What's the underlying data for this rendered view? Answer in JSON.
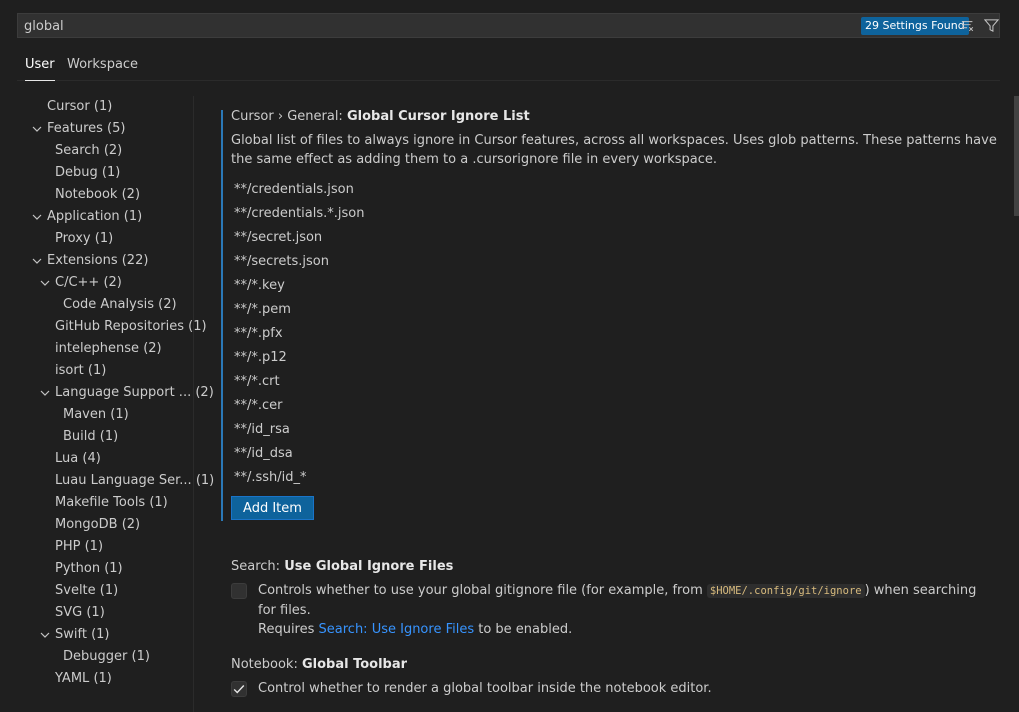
{
  "search": {
    "value": "global",
    "count_label": "29 Settings Found",
    "clear_icon": "clear-filter-icon",
    "filter_icon": "filter-icon"
  },
  "tabs": [
    {
      "label": "User",
      "active": true
    },
    {
      "label": "Workspace",
      "active": false
    }
  ],
  "toc": [
    {
      "label": "Cursor",
      "count": "(1)",
      "depth": 0,
      "expanded": null
    },
    {
      "label": "Features",
      "count": "(5)",
      "depth": 0,
      "expanded": true
    },
    {
      "label": "Search",
      "count": "(2)",
      "depth": 1,
      "expanded": null
    },
    {
      "label": "Debug",
      "count": "(1)",
      "depth": 1,
      "expanded": null
    },
    {
      "label": "Notebook",
      "count": "(2)",
      "depth": 1,
      "expanded": null
    },
    {
      "label": "Application",
      "count": "(1)",
      "depth": 0,
      "expanded": true
    },
    {
      "label": "Proxy",
      "count": "(1)",
      "depth": 1,
      "expanded": null
    },
    {
      "label": "Extensions",
      "count": "(22)",
      "depth": 0,
      "expanded": true
    },
    {
      "label": "C/C++",
      "count": "(2)",
      "depth": 1,
      "expanded": true
    },
    {
      "label": "Code Analysis",
      "count": "(2)",
      "depth": 2,
      "expanded": null
    },
    {
      "label": "GitHub Repositories",
      "count": "(1)",
      "depth": 1,
      "expanded": null
    },
    {
      "label": "intelephense",
      "count": "(2)",
      "depth": 1,
      "expanded": null
    },
    {
      "label": "isort",
      "count": "(1)",
      "depth": 1,
      "expanded": null
    },
    {
      "label": "Language Support ...",
      "count": "(2)",
      "depth": 1,
      "expanded": true,
      "truncated": true
    },
    {
      "label": "Maven",
      "count": "(1)",
      "depth": 2,
      "expanded": null
    },
    {
      "label": "Build",
      "count": "(1)",
      "depth": 2,
      "expanded": null
    },
    {
      "label": "Lua",
      "count": "(4)",
      "depth": 1,
      "expanded": null
    },
    {
      "label": "Luau Language Ser...",
      "count": "(1)",
      "depth": 1,
      "expanded": null,
      "truncated": true
    },
    {
      "label": "Makefile Tools",
      "count": "(1)",
      "depth": 1,
      "expanded": null
    },
    {
      "label": "MongoDB",
      "count": "(2)",
      "depth": 1,
      "expanded": null
    },
    {
      "label": "PHP",
      "count": "(1)",
      "depth": 1,
      "expanded": null
    },
    {
      "label": "Python",
      "count": "(1)",
      "depth": 1,
      "expanded": null
    },
    {
      "label": "Svelte",
      "count": "(1)",
      "depth": 1,
      "expanded": null
    },
    {
      "label": "SVG",
      "count": "(1)",
      "depth": 1,
      "expanded": null
    },
    {
      "label": "Swift",
      "count": "(1)",
      "depth": 1,
      "expanded": true
    },
    {
      "label": "Debugger",
      "count": "(1)",
      "depth": 2,
      "expanded": null
    },
    {
      "label": "YAML",
      "count": "(1)",
      "depth": 1,
      "expanded": null
    }
  ],
  "settings": {
    "ignore_list": {
      "category": "Cursor › General: ",
      "name": "Global Cursor Ignore List",
      "description": "Global list of files to always ignore in Cursor features, across all workspaces. Uses glob patterns. These patterns have the same effect as adding them to a .cursorignore file in every workspace.",
      "items": [
        "**/credentials.json",
        "**/credentials.*.json",
        "**/secret.json",
        "**/secrets.json",
        "**/*.key",
        "**/*.pem",
        "**/*.pfx",
        "**/*.p12",
        "**/*.crt",
        "**/*.cer",
        "**/id_rsa",
        "**/id_dsa",
        "**/.ssh/id_*"
      ],
      "add_label": "Add Item"
    },
    "global_ignore": {
      "category": "Search: ",
      "name": "Use Global Ignore Files",
      "desc_before": "Controls whether to use your global gitignore file (for example, from ",
      "code": "$HOME/.config/git/ignore",
      "desc_after": ") when searching for files.",
      "desc_line2_before": "Requires ",
      "link": "Search: Use Ignore Files",
      "desc_line2_after": " to be enabled.",
      "checked": false
    },
    "global_toolbar": {
      "category": "Notebook: ",
      "name": "Global Toolbar",
      "description": "Control whether to render a global toolbar inside the notebook editor.",
      "checked": true
    }
  }
}
